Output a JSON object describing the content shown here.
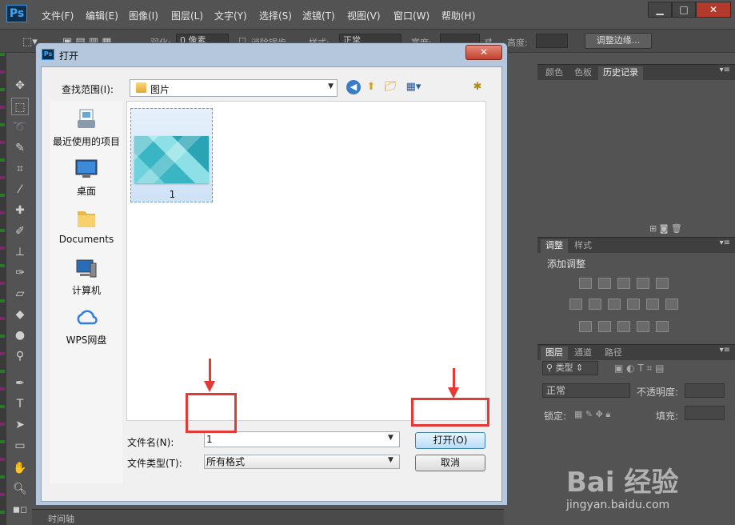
{
  "app": {
    "logo": "Ps",
    "menu": [
      "文件(F)",
      "编辑(E)",
      "图像(I)",
      "图层(L)",
      "文字(Y)",
      "选择(S)",
      "滤镜(T)",
      "视图(V)",
      "窗口(W)",
      "帮助(H)"
    ]
  },
  "options_bar": {
    "feather_label": "羽化:",
    "feather_value": "0 像素",
    "antialias_label": "消除锯齿",
    "style_label": "样式:",
    "style_value": "正常",
    "width_label": "宽度:",
    "height_label": "高度:",
    "refine_edge": "调整边缘..."
  },
  "timeline": {
    "label": "时间轴"
  },
  "panels": {
    "top_tabs": [
      "颜色",
      "色板",
      "历史记录"
    ],
    "adjust_tabs": [
      "调整",
      "样式"
    ],
    "adjust_title": "添加调整",
    "layer_tabs": [
      "图层",
      "通道",
      "路径"
    ],
    "kind_label": "类型",
    "blend_mode": "正常",
    "opacity_label": "不透明度:",
    "lock_label": "锁定:",
    "fill_label": "填充:"
  },
  "dialog": {
    "title": "打开",
    "look_in_label": "查找范围(I):",
    "look_in_value": "图片",
    "places": [
      "最近使用的项目",
      "桌面",
      "Documents",
      "计算机",
      "WPS网盘"
    ],
    "files": [
      {
        "name": "1"
      }
    ],
    "filename_label": "文件名(N):",
    "filename_value": "1",
    "filetype_label": "文件类型(T):",
    "filetype_value": "所有格式",
    "open_button": "打开(O)",
    "cancel_button": "取消"
  },
  "watermark": {
    "logo": "Bai 经验",
    "url": "jingyan.baidu.com"
  },
  "colors": {
    "ps_bg": "#535353",
    "dialog_frame": "#b4c7dc",
    "annotation": "#e53935",
    "selection": "#cfe2f6"
  },
  "icons": [
    "move-icon",
    "marquee-icon",
    "lasso-icon",
    "quick-select-icon",
    "crop-icon",
    "eyedropper-icon",
    "healing-icon",
    "brush-icon",
    "stamp-icon",
    "history-brush-icon",
    "eraser-icon",
    "bucket-icon",
    "blur-icon",
    "dodge-icon",
    "pen-icon",
    "type-icon",
    "path-select-icon",
    "shape-icon",
    "hand-icon",
    "zoom-icon"
  ]
}
